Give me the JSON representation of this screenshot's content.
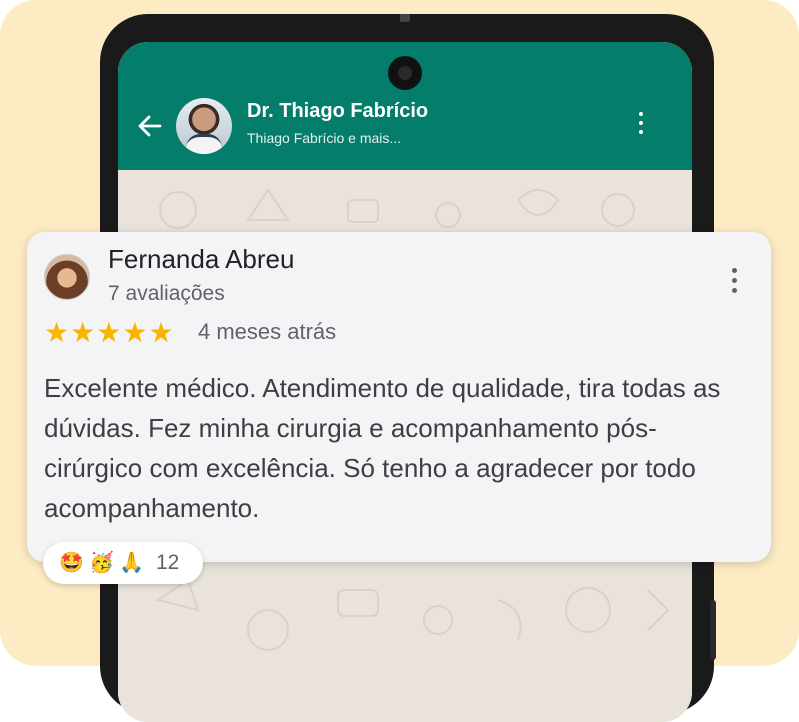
{
  "chat_header": {
    "name": "Dr. Thiago Fabrício",
    "subtitle": "Thiago Fabrício e mais..."
  },
  "review": {
    "author": "Fernanda Abreu",
    "review_count": "7 avaliações",
    "rating": 5,
    "rating_max": 5,
    "time_ago": "4 meses atrás",
    "text": "Excelente médico. Atendimento de qualidade, tira todas as dúvidas. Fez minha cirurgia e acompanhamento pós-cirúrgico com excelência. Só tenho a agradecer por todo acompanhamento."
  },
  "reactions": {
    "emojis": [
      "🤩",
      "🥳",
      "🙏"
    ],
    "count": "12"
  },
  "colors": {
    "header_green": "#047e6a",
    "star_yellow": "#f7b500",
    "background": "#fdebc4"
  },
  "icons": [
    "back-arrow-icon",
    "more-vert-icon",
    "star-icon"
  ]
}
